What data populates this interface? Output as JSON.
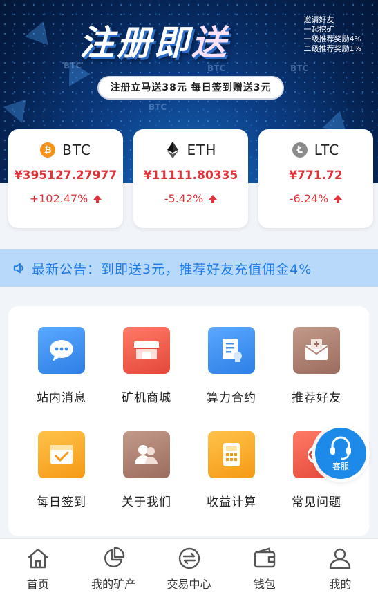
{
  "banner": {
    "title_part1": "注册即",
    "title_part2": "送",
    "invite_lines": [
      "邀请好友",
      "一起挖矿",
      "一级推荐奖励4%",
      "二级推荐奖励1%"
    ],
    "pill_text": "注册立马送38元 每日签到赠送3元",
    "watermark": "BTC"
  },
  "tickers": [
    {
      "symbol": "BTC",
      "icon": "bitcoin-icon",
      "price": "¥395127.27977",
      "change": "+102.47%",
      "trend": "up"
    },
    {
      "symbol": "ETH",
      "icon": "ethereum-icon",
      "price": "¥11111.80335",
      "change": "-5.42%",
      "trend": "up"
    },
    {
      "symbol": "LTC",
      "icon": "litecoin-icon",
      "price": "¥771.72",
      "change": "-6.24%",
      "trend": "up"
    }
  ],
  "notice": {
    "label": "最新公告：",
    "text": "到即送3元，推荐好友充值佣金4%"
  },
  "menu": [
    {
      "label": "站内消息",
      "icon": "message-icon",
      "color": "#3d8ff0"
    },
    {
      "label": "矿机商城",
      "icon": "shop-icon",
      "color": "#ee5a4c"
    },
    {
      "label": "算力合约",
      "icon": "contract-icon",
      "color": "#3d8ff0"
    },
    {
      "label": "推荐好友",
      "icon": "invite-icon",
      "color": "#a4786a"
    },
    {
      "label": "每日签到",
      "icon": "checkin-icon",
      "color": "#f8a325"
    },
    {
      "label": "关于我们",
      "icon": "about-icon",
      "color": "#a4786a"
    },
    {
      "label": "收益计算",
      "icon": "calculator-icon",
      "color": "#f8a325"
    },
    {
      "label": "常见问题",
      "icon": "faq-icon",
      "color": "#ee5a4c"
    }
  ],
  "support": {
    "label": "客服"
  },
  "tabs": [
    {
      "label": "首页",
      "icon": "home-icon"
    },
    {
      "label": "我的矿产",
      "icon": "pie-chart-icon"
    },
    {
      "label": "交易中心",
      "icon": "exchange-icon"
    },
    {
      "label": "钱包",
      "icon": "wallet-icon"
    },
    {
      "label": "我的",
      "icon": "user-icon"
    }
  ],
  "colors": {
    "accent": "#1b7be6",
    "price": "#e0333a",
    "notice_bg": "#b9d9fb"
  }
}
